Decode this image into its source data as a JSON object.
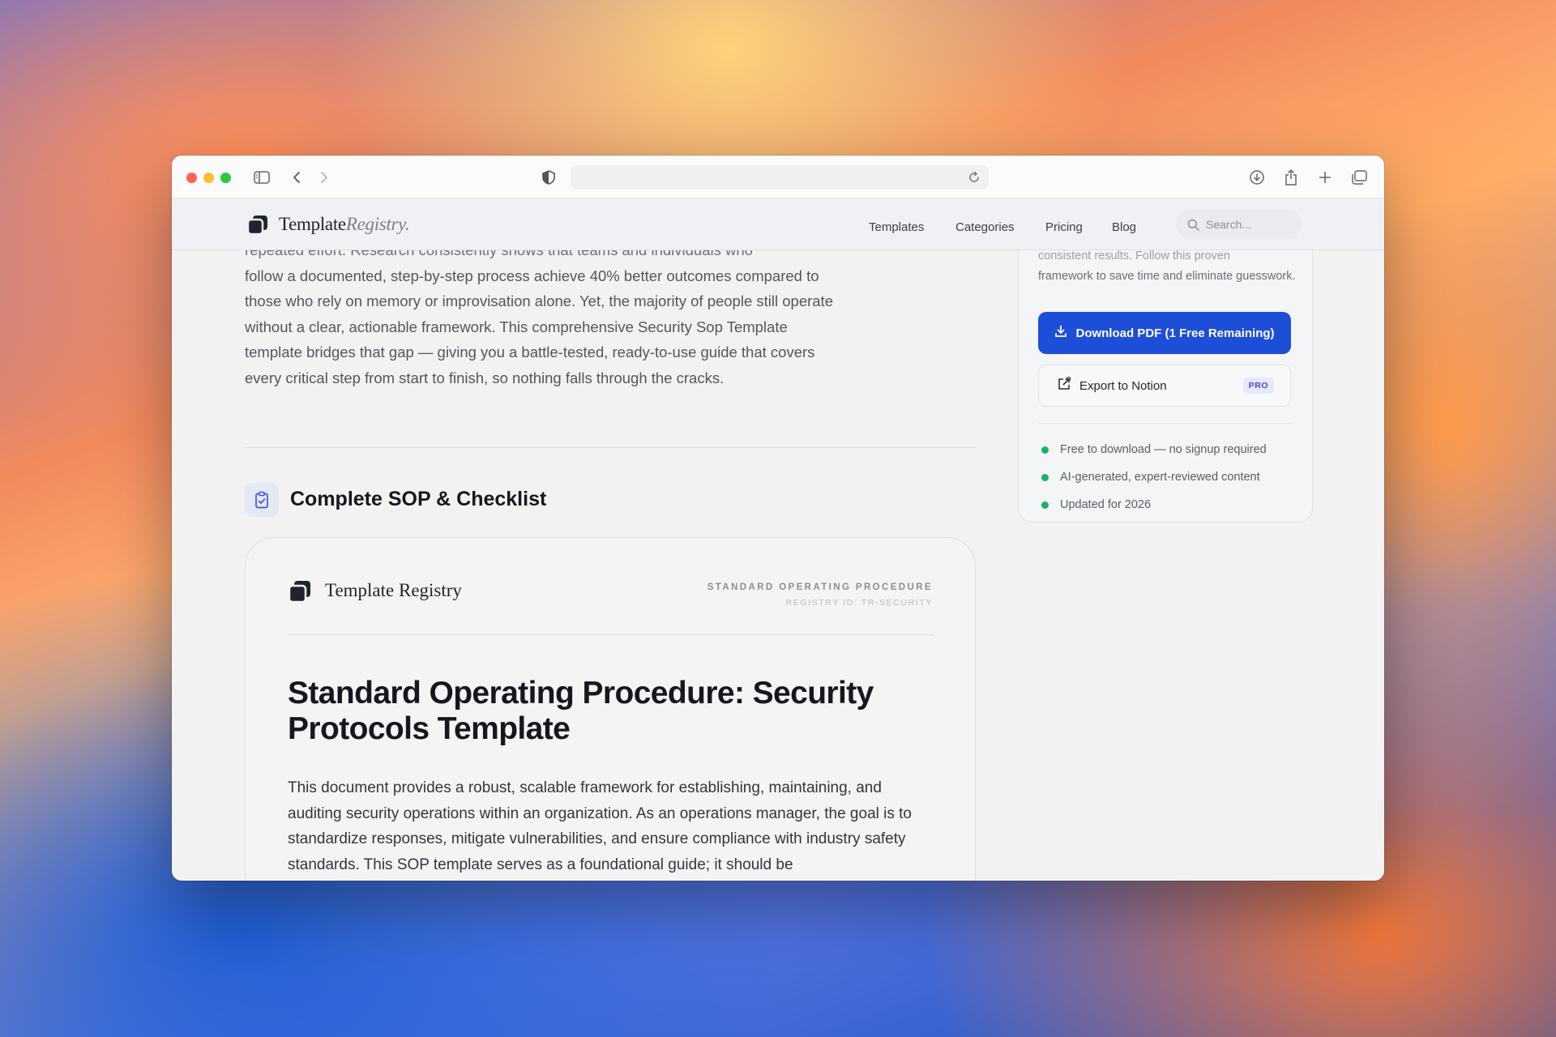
{
  "browser": {
    "title": "",
    "url": ""
  },
  "site": {
    "logo_word": "Template",
    "logo_italic": "Registry.",
    "nav": [
      "Templates",
      "Categories",
      "Pricing",
      "Blog"
    ],
    "search_placeholder": "Search..."
  },
  "article": {
    "intro_partial_top": "repeated effort. Research consistently shows that teams and individuals who",
    "intro": "follow a documented, step-by-step process achieve 40% better outcomes compared to those who rely on memory or improvisation alone. Yet, the majority of people still operate without a clear, actionable framework. This comprehensive Security Sop Template template bridges that gap — giving you a battle-tested, ready-to-use guide that covers every critical step from start to finish, so nothing falls through the cracks.",
    "section_title": "Complete SOP & Checklist"
  },
  "document": {
    "logo_text": "Template Registry",
    "doc_type": "STANDARD OPERATING PROCEDURE",
    "registry_id": "REGISTRY ID: TR-SECURITY",
    "title": "Standard Operating Procedure: Security Protocols Template",
    "body": "This document provides a robust, scalable framework for establishing, maintaining, and auditing security operations within an organization. As an operations manager, the goal is to standardize responses, mitigate vulnerabilities, and ensure compliance with industry safety standards. This SOP template serves as a foundational guide; it should be"
  },
  "sidebar": {
    "desc_partial_top": "consistent results. Follow this proven",
    "desc": "framework to save time and eliminate guesswork.",
    "download_label": "Download PDF (1 Free Remaining)",
    "notion_label": "Export to Notion",
    "pro_badge": "PRO",
    "features": [
      "Free to download — no signup required",
      "AI-generated, expert-reviewed content",
      "Updated for 2026"
    ]
  },
  "colors": {
    "accent": "#1d4ed8",
    "success": "#16b364"
  }
}
